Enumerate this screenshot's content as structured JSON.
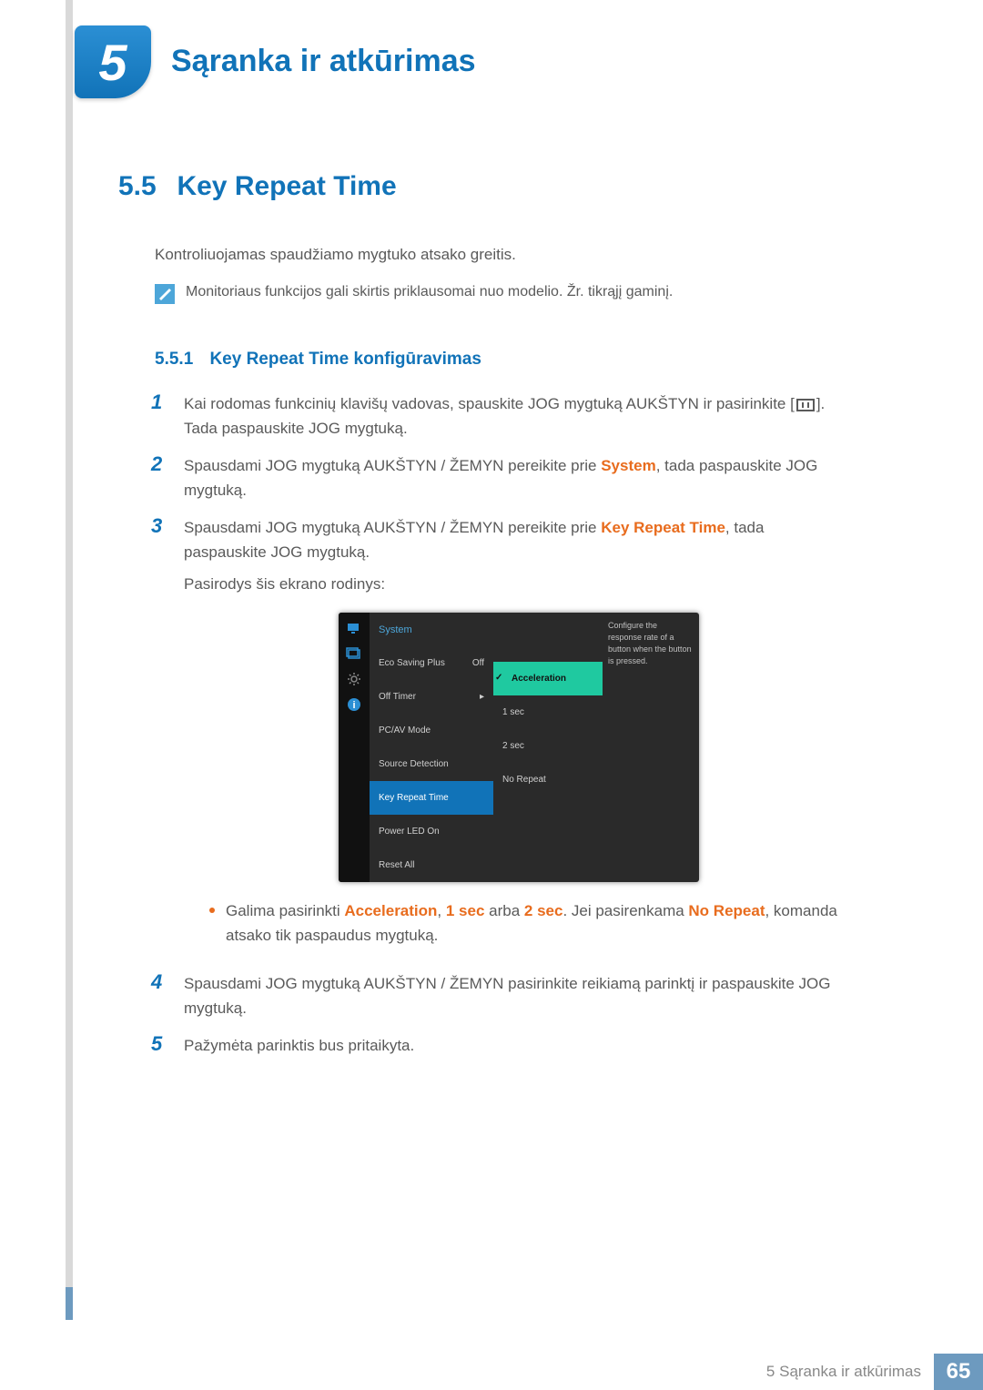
{
  "chapter": {
    "number": "5",
    "title": "Sąranka ir atkūrimas"
  },
  "section": {
    "number": "5.5",
    "title": "Key Repeat Time"
  },
  "intro": "Kontroliuojamas spaudžiamo mygtuko atsako greitis.",
  "note": "Monitoriaus funkcijos gali skirtis priklausomai nuo modelio. Žr. tikrąjį gaminį.",
  "subsection": {
    "number": "5.5.1",
    "title": "Key Repeat Time konfigūravimas"
  },
  "steps": {
    "s1a": "Kai rodomas funkcinių klavišų vadovas, spauskite JOG mygtuką AUKŠTYN ir pasirinkite [",
    "s1b": "]. Tada paspauskite JOG mygtuką.",
    "s2a": "Spausdami JOG mygtuką AUKŠTYN / ŽEMYN pereikite prie ",
    "s2hl": "System",
    "s2b": ", tada paspauskite JOG mygtuką.",
    "s3a": "Spausdami JOG mygtuką AUKŠTYN / ŽEMYN pereikite prie ",
    "s3hl": "Key Repeat Time",
    "s3b": ", tada paspauskite JOG mygtuką.",
    "s3c": "Pasirodys šis ekrano rodinys:",
    "bullet_a": "Galima pasirinkti ",
    "bullet_hl1": "Acceleration",
    "bullet_sep1": ", ",
    "bullet_hl2": "1 sec",
    "bullet_sep2": " arba ",
    "bullet_hl3": "2 sec",
    "bullet_mid": ". Jei pasirenkama ",
    "bullet_hl4": "No Repeat",
    "bullet_end": ", komanda atsako tik paspaudus mygtuką.",
    "s4": "Spausdami JOG mygtuką AUKŠTYN / ŽEMYN pasirinkite reikiamą parinktį ir paspauskite JOG mygtuką.",
    "s5": "Pažymėta parinktis bus pritaikyta.",
    "n1": "1",
    "n2": "2",
    "n3": "3",
    "n4": "4",
    "n5": "5"
  },
  "osd": {
    "head": "System",
    "items": {
      "eco": "Eco Saving Plus",
      "eco_val": "Off",
      "timer": "Off Timer",
      "timer_val": "▸",
      "pcav": "PC/AV Mode",
      "source": "Source Detection",
      "krt": "Key Repeat Time",
      "led": "Power LED On",
      "reset": "Reset All"
    },
    "opts": {
      "accel": "Acceleration",
      "one": "1 sec",
      "two": "2 sec",
      "norep": "No Repeat"
    },
    "help": "Configure the response rate of a button when the button is pressed."
  },
  "footer": {
    "text": "5 Sąranka ir atkūrimas",
    "page": "65"
  }
}
